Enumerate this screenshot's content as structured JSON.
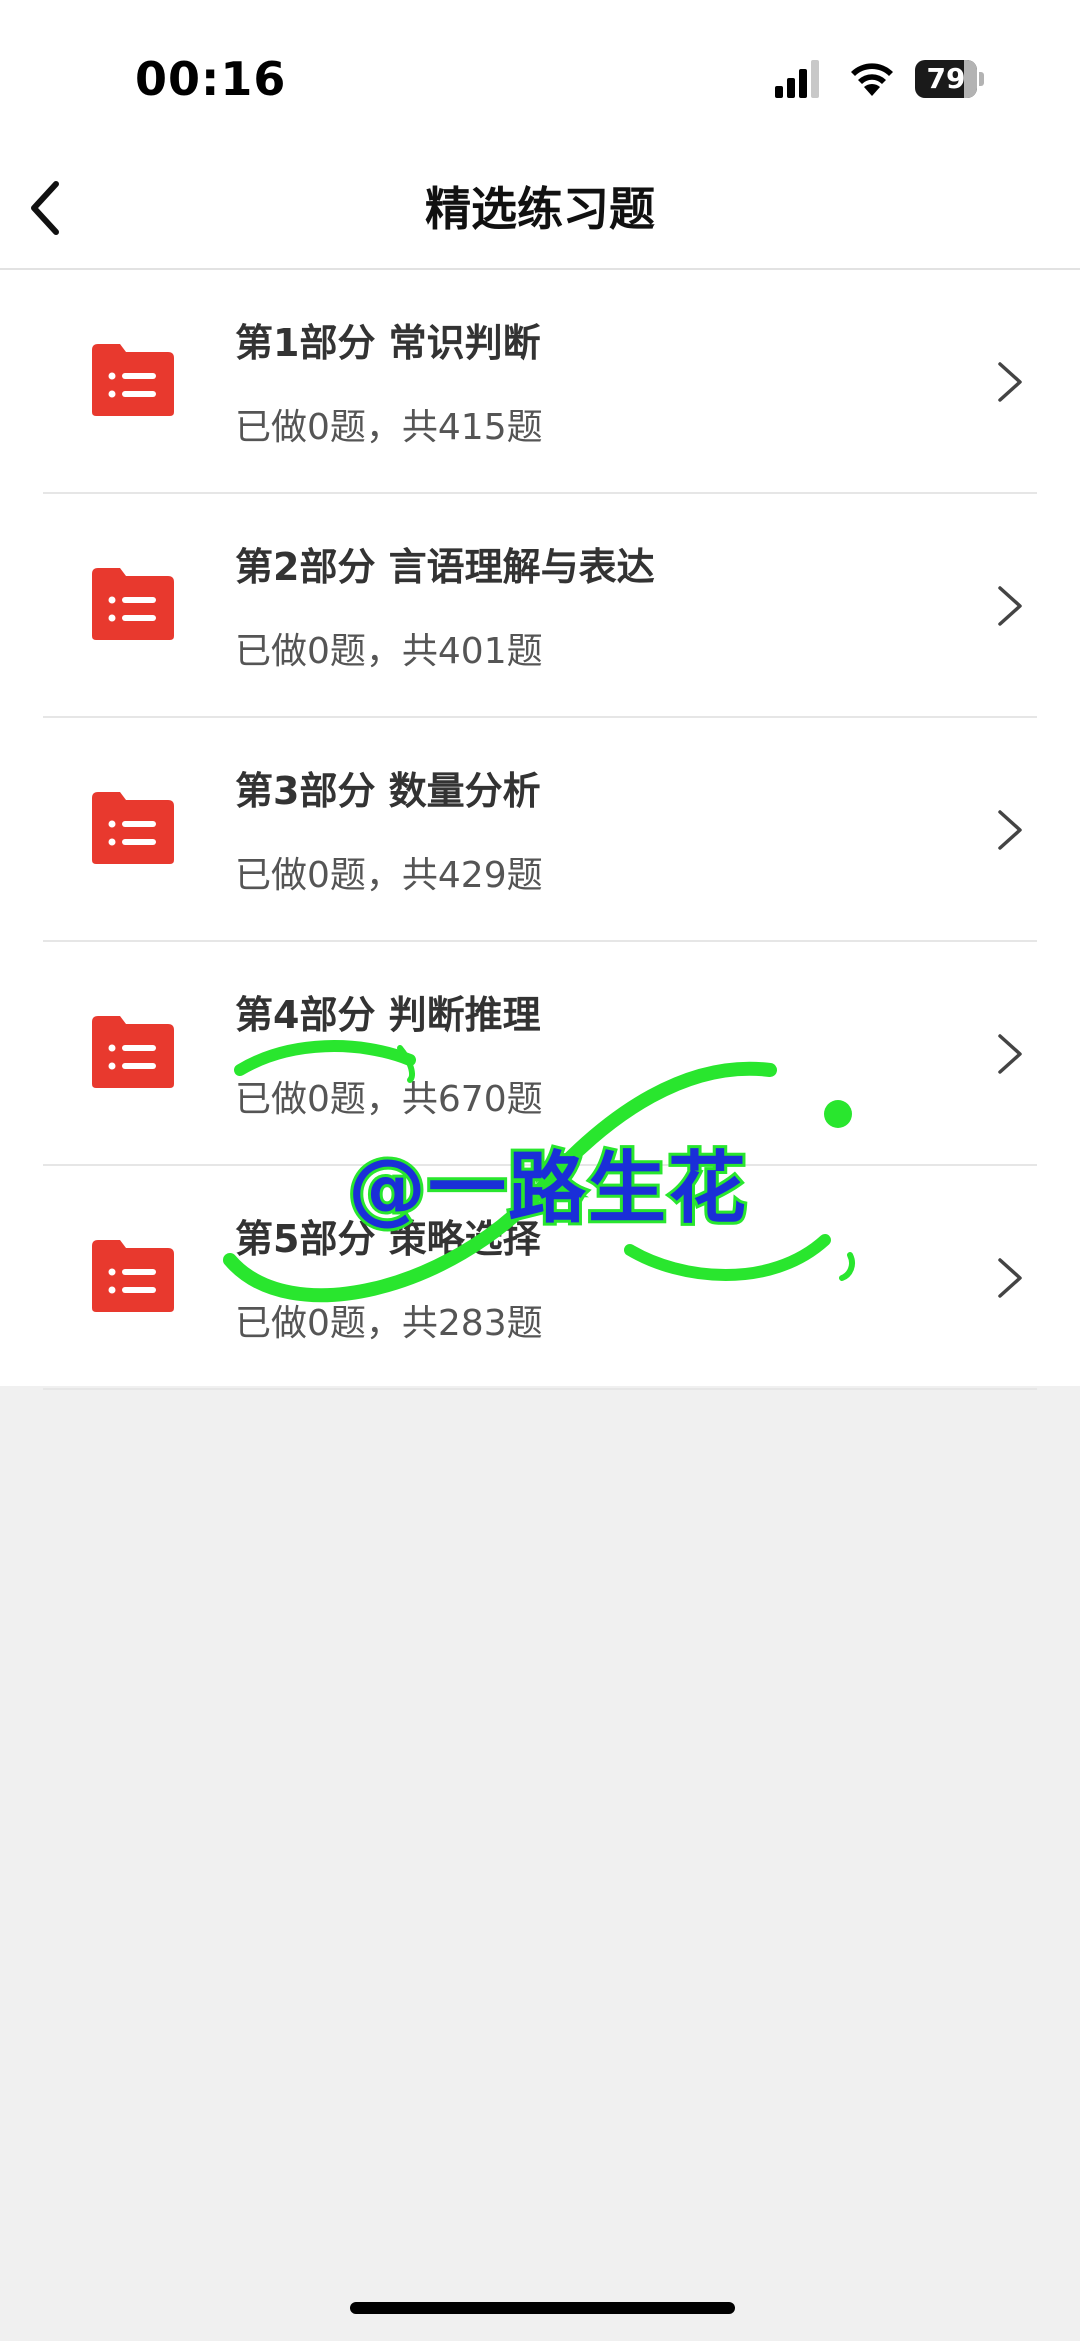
{
  "status_bar": {
    "time": "00:16",
    "battery_level": "79",
    "battery_fraction": 0.79
  },
  "nav": {
    "title": "精选练习题",
    "back_icon": "chevron-left-icon"
  },
  "items": [
    {
      "title": "第1部分 常识判断",
      "subtitle": "已做0题，共415题"
    },
    {
      "title": "第2部分 言语理解与表达",
      "subtitle": "已做0题，共401题"
    },
    {
      "title": "第3部分 数量分析",
      "subtitle": "已做0题，共429题"
    },
    {
      "title": "第4部分 判断推理",
      "subtitle": "已做0题，共670题"
    },
    {
      "title": "第5部分 策略选择",
      "subtitle": "已做0题，共283题"
    }
  ],
  "watermark": {
    "text": "@一路生花"
  },
  "colors": {
    "folder": "#e8392e",
    "watermark_text": "#1a2fd8",
    "watermark_stroke": "#29e62e"
  }
}
